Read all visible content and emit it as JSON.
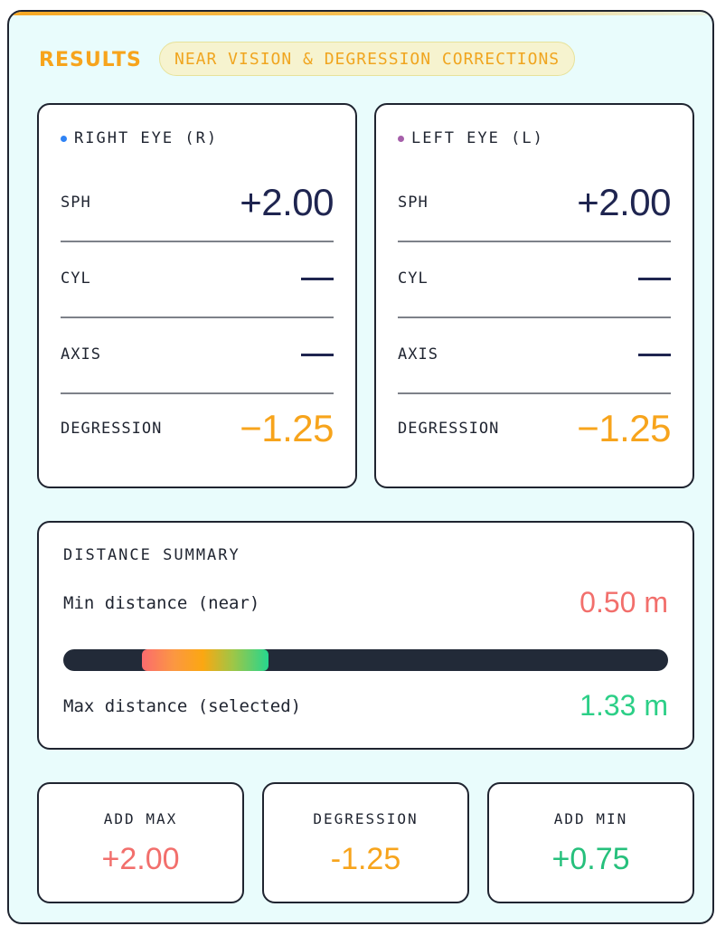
{
  "results": {
    "title": "RESULTS",
    "tag": "NEAR VISION & DEGRESSION CORRECTIONS"
  },
  "eyes": {
    "right": {
      "title": "RIGHT EYE (R)",
      "dot_color": "#2f83f5",
      "rows": {
        "sph": {
          "label": "SPH",
          "value": "+2.00"
        },
        "cyl": {
          "label": "CYL",
          "value": "—"
        },
        "axis": {
          "label": "AXIS",
          "value": "—"
        },
        "degression": {
          "label": "DEGRESSION",
          "value": "−1.25"
        }
      }
    },
    "left": {
      "title": "LEFT EYE (L)",
      "dot_color": "#a65faa",
      "rows": {
        "sph": {
          "label": "SPH",
          "value": "+2.00"
        },
        "cyl": {
          "label": "CYL",
          "value": "—"
        },
        "axis": {
          "label": "AXIS",
          "value": "—"
        },
        "degression": {
          "label": "DEGRESSION",
          "value": "−1.25"
        }
      }
    }
  },
  "distance_summary": {
    "title": "DISTANCE SUMMARY",
    "min_label": "Min distance (near)",
    "min_value": "0.50 m",
    "max_label": "Max distance (selected)",
    "max_value": "1.33 m",
    "range_fraction": {
      "start": 0.13,
      "end": 0.34
    }
  },
  "summary_cards": {
    "add_max": {
      "label": "ADD MAX",
      "value": "+2.00"
    },
    "degression": {
      "label": "DEGRESSION",
      "value": "-1.25"
    },
    "add_min": {
      "label": "ADD MIN",
      "value": "+0.75"
    }
  },
  "colors": {
    "accent_orange": "#f7a41c",
    "red": "#f26f6c",
    "green": "#2ccf87",
    "dark": "#1f2430",
    "panel_bg": "#e9fcfc"
  }
}
